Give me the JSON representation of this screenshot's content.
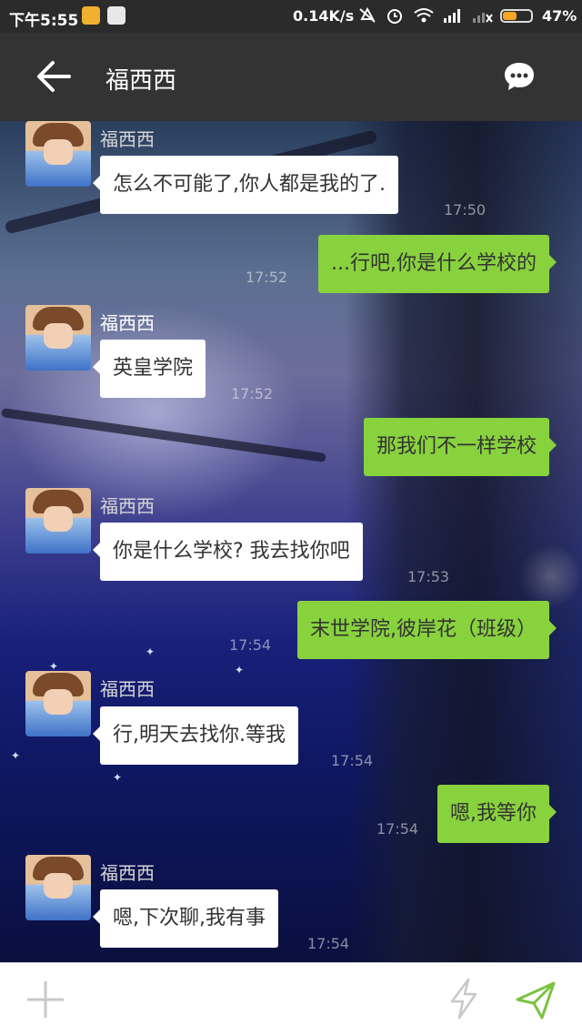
{
  "status_bar": {
    "time": "下午5:55",
    "network_speed": "0.14K/s",
    "battery_percent": "47%",
    "battery_level": 0.47,
    "icons": [
      "weibo-icon",
      "app-icon",
      "mute-icon",
      "alarm-icon",
      "wifi-icon",
      "signal-icon",
      "signal-off-icon",
      "battery-icon"
    ]
  },
  "header": {
    "title": "福西西",
    "back_icon": "arrow-left-icon",
    "menu_icon": "chat-bubble-icon"
  },
  "messages": [
    {
      "direction": "in",
      "sender": "福西西",
      "text": "怎么不可能了,你人都是我的了.",
      "time": "17:50"
    },
    {
      "direction": "out",
      "text": "...行吧,你是什么学校的",
      "time": "17:52"
    },
    {
      "direction": "in",
      "sender": "福西西",
      "text": "英皇学院",
      "time": "17:52"
    },
    {
      "direction": "out",
      "text": "那我们不一样学校",
      "time": ""
    },
    {
      "direction": "in",
      "sender": "福西西",
      "text": "你是什么学校? 我去找你吧",
      "time": "17:53"
    },
    {
      "direction": "out",
      "text": "末世学院,彼岸花（班级）",
      "time": "17:54"
    },
    {
      "direction": "in",
      "sender": "福西西",
      "text": "行,明天去找你.等我",
      "time": "17:54"
    },
    {
      "direction": "out",
      "text": "嗯,我等你",
      "time": "17:54"
    },
    {
      "direction": "in",
      "sender": "福西西",
      "text": "嗯,下次聊,我有事",
      "time": "17:54"
    }
  ],
  "bottom_bar": {
    "icons": [
      "plus-icon",
      "lightning-icon",
      "send-icon"
    ]
  },
  "colors": {
    "header_bg": "#333333",
    "outgoing_bubble": "#88d23e",
    "incoming_bubble": "#ffffff",
    "send_icon": "#7cc242"
  }
}
